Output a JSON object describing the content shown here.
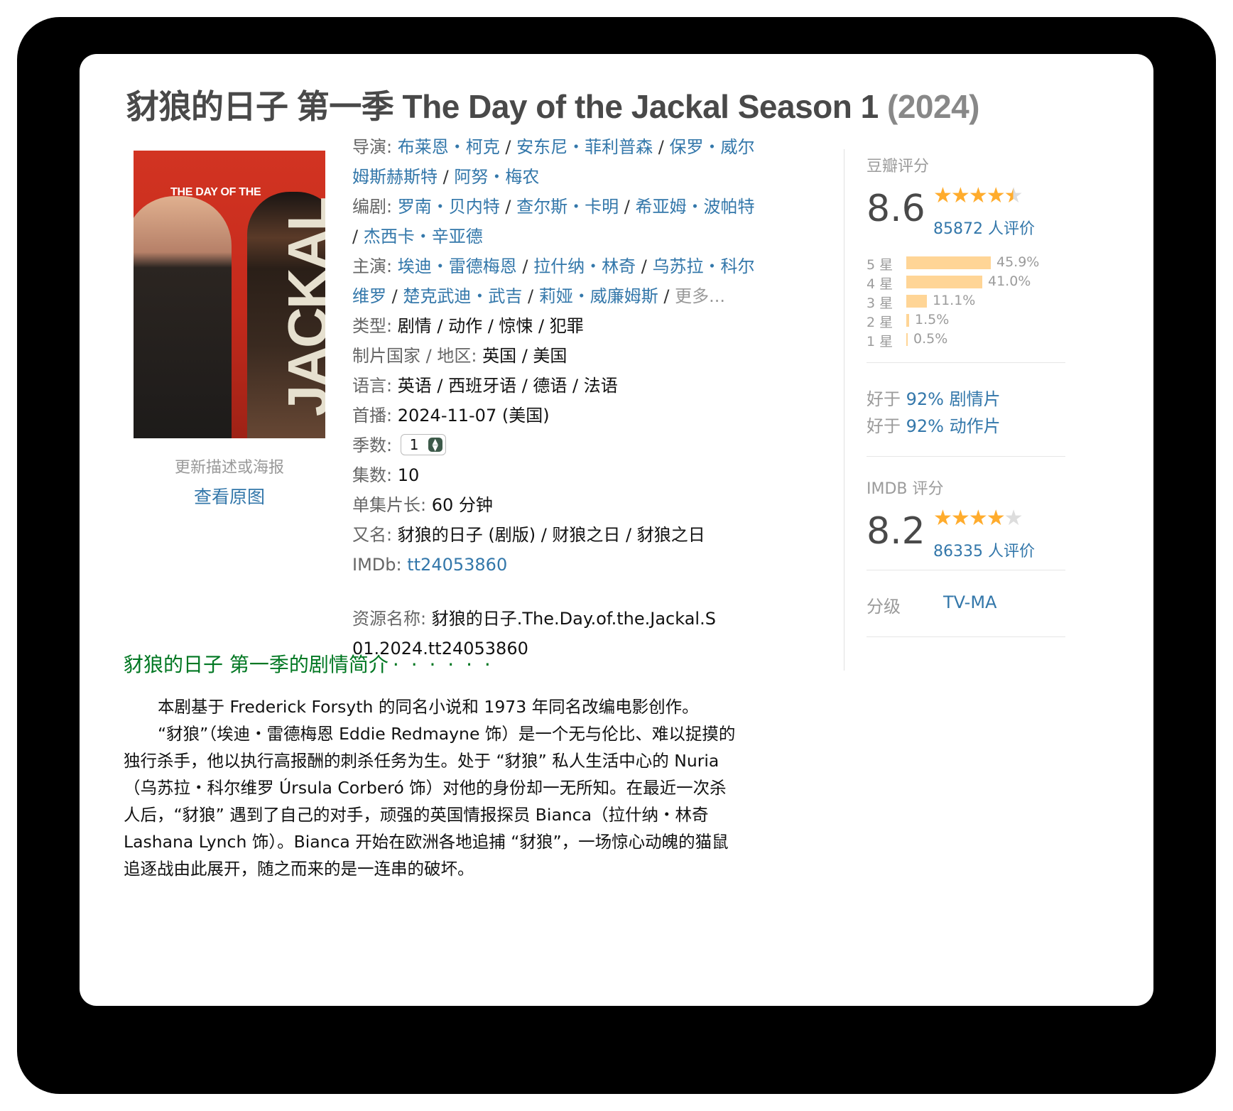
{
  "header": {
    "title": "豺狼的日子 第一季 The Day of the Jackal Season 1",
    "year": "(2024)"
  },
  "poster": {
    "top_text": "THE DAY OF THE",
    "big_text": "JACKAL",
    "update_link": "更新描述或海报",
    "view_link": "查看原图"
  },
  "info": {
    "director_label": "导演",
    "directors": [
      "布莱恩・柯克",
      "安东尼・菲利普森",
      "保罗・威尔姆斯赫斯特",
      "阿努・梅农"
    ],
    "writer_label": "编剧",
    "writers": [
      "罗南・贝内特",
      "查尔斯・卡明",
      "希亚姆・波帕特",
      "杰西卡・辛亚德"
    ],
    "cast_label": "主演",
    "cast": [
      "埃迪・雷德梅恩",
      "拉什纳・林奇",
      "乌苏拉・科尔维罗",
      "楚克武迪・武吉",
      "莉娅・威廉姆斯"
    ],
    "cast_more": "更多...",
    "genre_label": "类型:",
    "genre_value": "剧情 / 动作 / 惊悚 / 犯罪",
    "country_label": "制片国家 / 地区:",
    "country_value": "英国 / 美国",
    "language_label": "语言:",
    "language_value": "英语 / 西班牙语 / 德语 / 法语",
    "premiere_label": "首播:",
    "premiere_value": "2024-11-07 (美国)",
    "season_label": "季数:",
    "season_value": "1",
    "episodes_label": "集数:",
    "episodes_value": "10",
    "runtime_label": "单集片长:",
    "runtime_value": "60 分钟",
    "aka_label": "又名:",
    "aka_value": "豺狼的日子 (剧版) / 财狼之日 / 豺狼之日",
    "imdb_label": "IMDb:",
    "imdb_value": "tt24053860",
    "resource_label": "资源名称:",
    "resource_value": "豺狼的日子.The.Day.of.the.Jackal.S01.2024.tt24053860"
  },
  "douban": {
    "label": "豆瓣评分",
    "score": "8.6",
    "stars": 4.5,
    "count": "85872 人评价",
    "breakdown": [
      {
        "label": "5 星",
        "pct_text": "45.9%",
        "pct": 45.9
      },
      {
        "label": "4 星",
        "pct_text": "41.0%",
        "pct": 41.0
      },
      {
        "label": "3 星",
        "pct_text": "11.1%",
        "pct": 11.1
      },
      {
        "label": "2 星",
        "pct_text": "1.5%",
        "pct": 1.5
      },
      {
        "label": "1 星",
        "pct_text": "0.5%",
        "pct": 0.5
      }
    ],
    "better1_prefix": "好于",
    "better1_link": "92% 剧情片",
    "better2_prefix": "好于",
    "better2_link": "92% 动作片"
  },
  "imdb": {
    "label": "IMDB 评分",
    "score": "8.2",
    "stars": 4,
    "count": "86335 人评价"
  },
  "rating_class": {
    "label": "分级",
    "value": "TV-MA"
  },
  "summary": {
    "title": "豺狼的日子 第一季的剧情简介",
    "dots": "· · · · · ·",
    "paragraphs": [
      "本剧基于 Frederick Forsyth 的同名小说和 1973 年同名改编电影创作。",
      "“豺狼”（埃迪・雷德梅恩 Eddie Redmayne 饰）是一个无与伦比、难以捉摸的独行杀手，他以执行高报酬的刺杀任务为生。处于 “豺狼” 私人生活中心的 Nuria（乌苏拉・科尔维罗 Úrsula Corberó 饰）对他的身份却一无所知。在最近一次杀人后，“豺狼” 遇到了自己的对手，顽强的英国情报探员 Bianca（拉什纳・林奇 Lashana Lynch 饰）。Bianca 开始在欧洲各地追捕 “豺狼”，一场惊心动魄的猫鼠追逐战由此展开，随之而来的是一连串的破坏。"
    ]
  },
  "colors": {
    "link": "#3377aa",
    "summary_green": "#007722",
    "bar": "#ffd596",
    "star": "#ffac2d"
  }
}
